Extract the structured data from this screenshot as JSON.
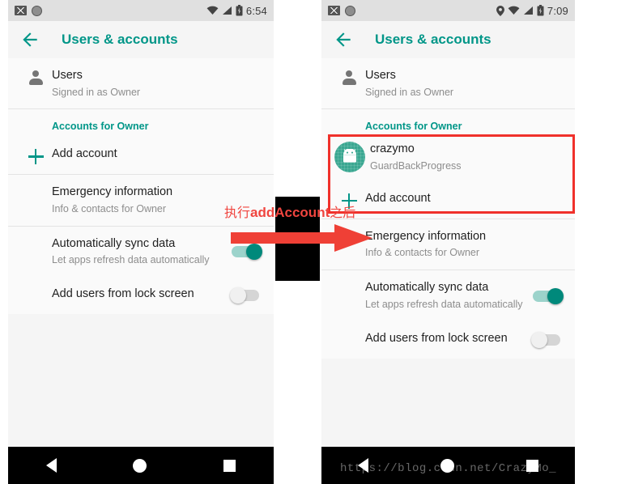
{
  "annotation": {
    "text_before": "执行",
    "text_mono": "addAccount",
    "text_after": "之后",
    "arrow_name": "red-right-arrow",
    "color": "#f0453f"
  },
  "watermark": "https://blog.csdn.net/CrazyMo_",
  "highlight_color": "#f0312b",
  "accent_color": "#009688",
  "phones": [
    {
      "id": "before",
      "status_bar": {
        "time": "6:54",
        "icons": [
          "photo-icon",
          "circle-icon"
        ],
        "right_icons": [
          "wifi-icon",
          "signal-icon",
          "battery-icon"
        ],
        "has_location": false
      },
      "app_bar": {
        "back": "back-arrow",
        "title": "Users & accounts"
      },
      "users_row": {
        "title": "Users",
        "subtitle": "Signed in as Owner",
        "icon": "person-icon"
      },
      "accounts_header": "Accounts for Owner",
      "accounts": [],
      "add_account": {
        "title": "Add account",
        "icon": "plus-icon"
      },
      "emergency": {
        "title": "Emergency information",
        "subtitle": "Info & contacts for Owner"
      },
      "sync": {
        "title": "Automatically sync data",
        "subtitle": "Let apps refresh data automatically",
        "state": "on"
      },
      "lock_screen": {
        "title": "Add users from lock screen",
        "state": "off"
      },
      "nav": {
        "back": "nav-back-icon",
        "home": "nav-home-icon",
        "recents": "nav-recents-icon"
      },
      "highlighted": false,
      "show_watermark": false
    },
    {
      "id": "after",
      "status_bar": {
        "time": "7:09",
        "icons": [
          "photo-icon",
          "circle-icon"
        ],
        "right_icons": [
          "location-icon",
          "wifi-icon",
          "signal-icon",
          "battery-icon"
        ],
        "has_location": true
      },
      "app_bar": {
        "back": "back-arrow",
        "title": "Users & accounts"
      },
      "users_row": {
        "title": "Users",
        "subtitle": "Signed in as Owner",
        "icon": "person-icon"
      },
      "accounts_header": "Accounts for Owner",
      "accounts": [
        {
          "name": "crazymo",
          "type": "GuardBackProgress",
          "avatar": "android-robot-avatar"
        }
      ],
      "add_account": {
        "title": "Add account",
        "icon": "plus-icon"
      },
      "emergency": {
        "title": "Emergency information",
        "subtitle": "Info & contacts for Owner"
      },
      "sync": {
        "title": "Automatically sync data",
        "subtitle": "Let apps refresh data automatically",
        "state": "on"
      },
      "lock_screen": {
        "title": "Add users from lock screen",
        "state": "off"
      },
      "nav": {
        "back": "nav-back-icon",
        "home": "nav-home-icon",
        "recents": "nav-recents-icon"
      },
      "highlighted": true,
      "show_watermark": true
    }
  ]
}
